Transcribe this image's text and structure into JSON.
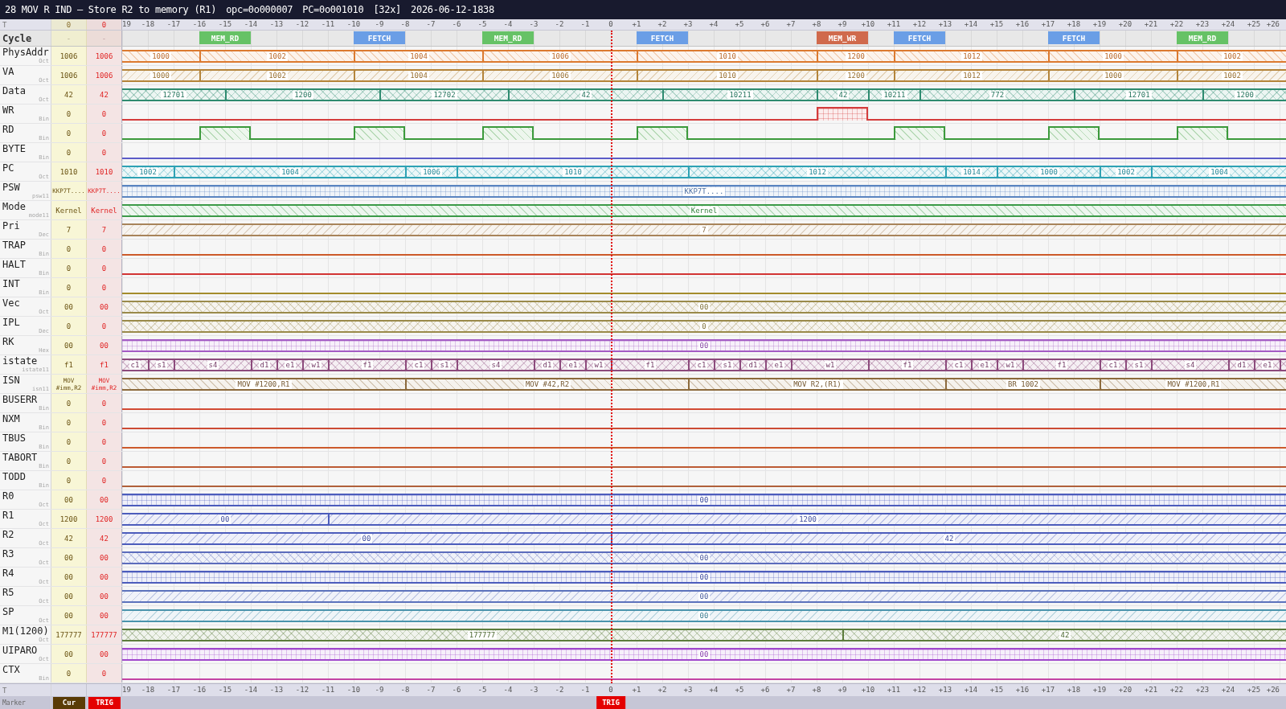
{
  "title_bar": {
    "title": "28 MOV R IND — Store R2 to memory (R1)",
    "fields": [
      "opc=0o000007",
      "PC=0o001010",
      "[32x]",
      "2026-06-12-1838"
    ]
  },
  "top_ruler": {
    "label": "T",
    "cur": "0",
    "trig": "0",
    "ticks": [
      "19",
      "-18",
      "-17",
      "-16",
      "-15",
      "-14",
      "-13",
      "-12",
      "-11",
      "-10",
      "-9",
      "-8",
      "-7",
      "-6",
      "-5",
      "-4",
      "-3",
      "-2",
      "-1",
      "0",
      "+1",
      "+2",
      "+3",
      "+4",
      "+5",
      "+6",
      "+7",
      "+8",
      "+9",
      "+10",
      "+11",
      "+12",
      "+13",
      "+14",
      "+15",
      "+16",
      "+17",
      "+18",
      "+19",
      "+20",
      "+21",
      "+22",
      "+23",
      "+24",
      "+25",
      "+26"
    ]
  },
  "cycle_row": {
    "label": "Cycle",
    "cur": "-",
    "trig": "-",
    "cycles": [
      {
        "label": "MEM_RD",
        "color": "#66c266"
      },
      {
        "label": "FETCH",
        "color": "#6a9ee6"
      },
      {
        "label": "MEM_RD",
        "color": "#66c266"
      },
      {
        "label": "FETCH",
        "color": "#6a9ee6"
      },
      {
        "label": "MEM_WR",
        "color": "#d06a4c"
      },
      {
        "label": "FETCH",
        "color": "#6a9ee6"
      },
      {
        "label": "FETCH",
        "color": "#6a9ee6"
      },
      {
        "label": "MEM_RD",
        "color": "#66c266"
      }
    ]
  },
  "signals": [
    {
      "name": "PhysAddr",
      "format": "Oct",
      "cur": "1006",
      "trig": "1006",
      "kind": "bus",
      "color": "#dc7a30",
      "segments": [
        {
          "value": "1000"
        },
        {
          "value": "1002"
        },
        {
          "value": "1004"
        },
        {
          "value": "1006"
        },
        {
          "value": "1010"
        },
        {
          "value": "1200"
        },
        {
          "value": "1012"
        },
        {
          "value": "1000"
        },
        {
          "value": "1002"
        }
      ]
    },
    {
      "name": "VA",
      "format": "Oct",
      "cur": "1006",
      "trig": "1006",
      "kind": "bus",
      "color": "#b4843a",
      "segments": [
        {
          "value": "1000"
        },
        {
          "value": "1002"
        },
        {
          "value": "1004"
        },
        {
          "value": "1006"
        },
        {
          "value": "1010"
        },
        {
          "value": "1200"
        },
        {
          "value": "1012"
        },
        {
          "value": "1000"
        },
        {
          "value": "1002"
        }
      ]
    },
    {
      "name": "Data",
      "format": "Oct",
      "cur": "42",
      "trig": "42",
      "kind": "bus",
      "color": "#2e8b70",
      "segments": [
        {
          "value": "12701"
        },
        {
          "value": "1200"
        },
        {
          "value": "12702"
        },
        {
          "value": "42"
        },
        {
          "value": "10211"
        },
        {
          "value": "42"
        },
        {
          "value": "10211"
        },
        {
          "value": "772"
        },
        {
          "value": "12701"
        },
        {
          "value": "1200"
        }
      ]
    },
    {
      "name": "WR",
      "format": "Bin",
      "cur": "0",
      "trig": "0",
      "kind": "bit",
      "color": "#d43c3c",
      "segments": [
        {
          "high": false
        },
        {
          "high": true
        },
        {
          "high": false
        }
      ]
    },
    {
      "name": "RD",
      "format": "Bin",
      "cur": "0",
      "trig": "0",
      "kind": "bit",
      "color": "#3c9a3c",
      "segments": [
        {
          "high": false
        },
        {
          "high": true
        },
        {
          "high": false
        },
        {
          "high": true
        },
        {
          "high": false
        },
        {
          "high": true
        },
        {
          "high": false
        },
        {
          "high": true
        },
        {
          "high": false
        },
        {
          "high": true
        },
        {
          "high": false
        },
        {
          "high": true
        },
        {
          "high": false
        },
        {
          "high": true
        },
        {
          "high": false
        }
      ]
    },
    {
      "name": "BYTE",
      "format": "Bin",
      "cur": "0",
      "trig": "0",
      "kind": "bit",
      "color": "#5c5cc8",
      "segments": [
        {
          "high": false
        }
      ]
    },
    {
      "name": "PC",
      "format": "Oct",
      "cur": "1010",
      "trig": "1010",
      "kind": "bus",
      "color": "#2ea2b4",
      "segments": [
        {
          "value": "1002"
        },
        {
          "value": "1004"
        },
        {
          "value": "1006"
        },
        {
          "value": "1010"
        },
        {
          "value": "1012"
        },
        {
          "value": "1014"
        },
        {
          "value": "1000"
        },
        {
          "value": "1002"
        },
        {
          "value": "1004"
        }
      ]
    },
    {
      "name": "PSW",
      "format": "psw11",
      "cur": "KKP7T....",
      "trig": "KKP7T....",
      "kind": "bus",
      "color": "#5a84c0",
      "segments": [
        {
          "value": "KKP7T...."
        }
      ]
    },
    {
      "name": "Mode",
      "format": "mode11",
      "cur": "Kernel",
      "trig": "Kernel",
      "kind": "bus",
      "color": "#3c9a48",
      "segments": [
        {
          "value": "Kernel"
        }
      ]
    },
    {
      "name": "Pri",
      "format": "Dec",
      "cur": "7",
      "trig": "7",
      "kind": "bus",
      "color": "#a8845a",
      "segments": [
        {
          "value": "7"
        }
      ]
    },
    {
      "name": "TRAP",
      "format": "Bin",
      "cur": "0",
      "trig": "0",
      "kind": "bit",
      "color": "#cc5a2a",
      "segments": [
        {
          "high": false
        }
      ]
    },
    {
      "name": "HALT",
      "format": "Bin",
      "cur": "0",
      "trig": "0",
      "kind": "bit",
      "color": "#d23434",
      "segments": [
        {
          "high": false
        }
      ]
    },
    {
      "name": "INT",
      "format": "Bin",
      "cur": "0",
      "trig": "0",
      "kind": "bit",
      "color": "#a48c2c",
      "segments": [
        {
          "high": false
        }
      ]
    },
    {
      "name": "Vec",
      "format": "Oct",
      "cur": "00",
      "trig": "00",
      "kind": "bus",
      "color": "#9a8a4a",
      "segments": [
        {
          "value": "00"
        }
      ]
    },
    {
      "name": "IPL",
      "format": "Dec",
      "cur": "0",
      "trig": "0",
      "kind": "bus",
      "color": "#9a8a4a",
      "segments": [
        {
          "value": "0"
        }
      ]
    },
    {
      "name": "RK",
      "format": "Hex",
      "cur": "00",
      "trig": "00",
      "kind": "bus",
      "color": "#a45cc4",
      "segments": [
        {
          "value": "00"
        }
      ]
    },
    {
      "name": "istate",
      "format": "istate11",
      "cur": "f1",
      "trig": "f1",
      "kind": "bus",
      "color": "#8c4a7c",
      "segments": [
        {
          "value": "c1"
        },
        {
          "value": "s1"
        },
        {
          "value": "s4"
        },
        {
          "value": "d1"
        },
        {
          "value": "e1"
        },
        {
          "value": "w1"
        },
        {
          "value": "f1"
        },
        {
          "value": "c1"
        },
        {
          "value": "s1"
        },
        {
          "value": "s4"
        },
        {
          "value": "d1"
        },
        {
          "value": "e1"
        },
        {
          "value": "w1"
        },
        {
          "value": "f1"
        },
        {
          "value": "c1"
        },
        {
          "value": "s1"
        },
        {
          "value": "d1"
        },
        {
          "value": "e1"
        },
        {
          "value": "w1"
        },
        {
          "value": "f1"
        },
        {
          "value": "c1"
        },
        {
          "value": "e1"
        },
        {
          "value": "w1"
        },
        {
          "value": "f1"
        },
        {
          "value": "c1"
        },
        {
          "value": "s1"
        },
        {
          "value": "s4"
        },
        {
          "value": "d1"
        },
        {
          "value": "e1"
        }
      ]
    },
    {
      "name": "ISN",
      "format": "isn11",
      "cur": "MOV #imm,R2",
      "trig": "MOV #imm,R2",
      "kind": "bus",
      "color": "#8c6a3c",
      "segments": [
        {
          "value": "MOV #1200,R1"
        },
        {
          "value": "MOV #42,R2"
        },
        {
          "value": "MOV R2,(R1)"
        },
        {
          "value": "BR 1002"
        },
        {
          "value": "MOV #1200,R1"
        }
      ]
    },
    {
      "name": "BUSERR",
      "format": "Bin",
      "cur": "0",
      "trig": "0",
      "kind": "bit",
      "color": "#d24a34",
      "segments": [
        {
          "high": false
        }
      ]
    },
    {
      "name": "NXM",
      "format": "Bin",
      "cur": "0",
      "trig": "0",
      "kind": "bit",
      "color": "#cc4a34",
      "segments": [
        {
          "high": false
        }
      ]
    },
    {
      "name": "TBUS",
      "format": "Bin",
      "cur": "0",
      "trig": "0",
      "kind": "bit",
      "color": "#cc5a2c",
      "segments": [
        {
          "high": false
        }
      ]
    },
    {
      "name": "TABORT",
      "format": "Bin",
      "cur": "0",
      "trig": "0",
      "kind": "bit",
      "color": "#bc5a34",
      "segments": [
        {
          "high": false
        }
      ]
    },
    {
      "name": "TODD",
      "format": "Bin",
      "cur": "0",
      "trig": "0",
      "kind": "bit",
      "color": "#b0603a",
      "segments": [
        {
          "high": false
        }
      ]
    },
    {
      "name": "R0",
      "format": "Oct",
      "cur": "00",
      "trig": "00",
      "kind": "bus",
      "color": "#4c5cbc",
      "segments": [
        {
          "value": "00"
        }
      ]
    },
    {
      "name": "R1",
      "format": "Oct",
      "cur": "1200",
      "trig": "1200",
      "kind": "bus",
      "color": "#4c5cbc",
      "segments": [
        {
          "value": "00"
        },
        {
          "value": "1200"
        }
      ]
    },
    {
      "name": "R2",
      "format": "Oct",
      "cur": "42",
      "trig": "42",
      "kind": "bus",
      "color": "#4c5cbc",
      "segments": [
        {
          "value": "00"
        },
        {
          "value": "42"
        }
      ]
    },
    {
      "name": "R3",
      "format": "Oct",
      "cur": "00",
      "trig": "00",
      "kind": "bus",
      "color": "#5c6cbc",
      "segments": [
        {
          "value": "00"
        }
      ]
    },
    {
      "name": "R4",
      "format": "Oct",
      "cur": "00",
      "trig": "00",
      "kind": "bus",
      "color": "#4c5cbc",
      "segments": [
        {
          "value": "00"
        }
      ]
    },
    {
      "name": "R5",
      "format": "Oct",
      "cur": "00",
      "trig": "00",
      "kind": "bus",
      "color": "#5c72bc",
      "segments": [
        {
          "value": "00"
        }
      ]
    },
    {
      "name": "SP",
      "format": "Oct",
      "cur": "00",
      "trig": "00",
      "kind": "bus",
      "color": "#4a94ac",
      "segments": [
        {
          "value": "00"
        }
      ]
    },
    {
      "name": "M1(1200)",
      "format": "Oct",
      "cur": "177777",
      "trig": "177777",
      "kind": "bus",
      "color": "#5c7c3c",
      "segments": [
        {
          "value": "177777"
        },
        {
          "value": "42"
        }
      ]
    },
    {
      "name": "UIPARO",
      "format": "Oct",
      "cur": "00",
      "trig": "00",
      "kind": "bus",
      "color": "#a048cc",
      "segments": [
        {
          "value": "00"
        }
      ]
    },
    {
      "name": "CTX",
      "format": "Bin",
      "cur": "0",
      "trig": "0",
      "kind": "bit",
      "color": "#c444a4",
      "segments": [
        {
          "high": false
        }
      ]
    }
  ],
  "bottom_ruler": {
    "label": "T",
    "ticks": [
      "19",
      "-18",
      "-17",
      "-16",
      "-15",
      "-14",
      "-13",
      "-12",
      "-11",
      "-10",
      "-9",
      "-8",
      "-7",
      "-6",
      "-5",
      "-4",
      "-3",
      "-2",
      "-1",
      "0",
      "+1",
      "+2",
      "+3",
      "+4",
      "+5",
      "+6",
      "+7",
      "+8",
      "+9",
      "+10",
      "+11",
      "+12",
      "+13",
      "+14",
      "+15",
      "+16",
      "+17",
      "+18",
      "+19",
      "+20",
      "+21",
      "+22",
      "+23",
      "+24",
      "+25",
      "+26"
    ]
  },
  "marker_bar": {
    "label": "Marker",
    "buttons": [
      {
        "label": "Cur",
        "kind": "cur"
      },
      {
        "label": "TRIG",
        "kind": "trig"
      }
    ],
    "trigger_marker": {
      "label": "TRIG"
    }
  }
}
